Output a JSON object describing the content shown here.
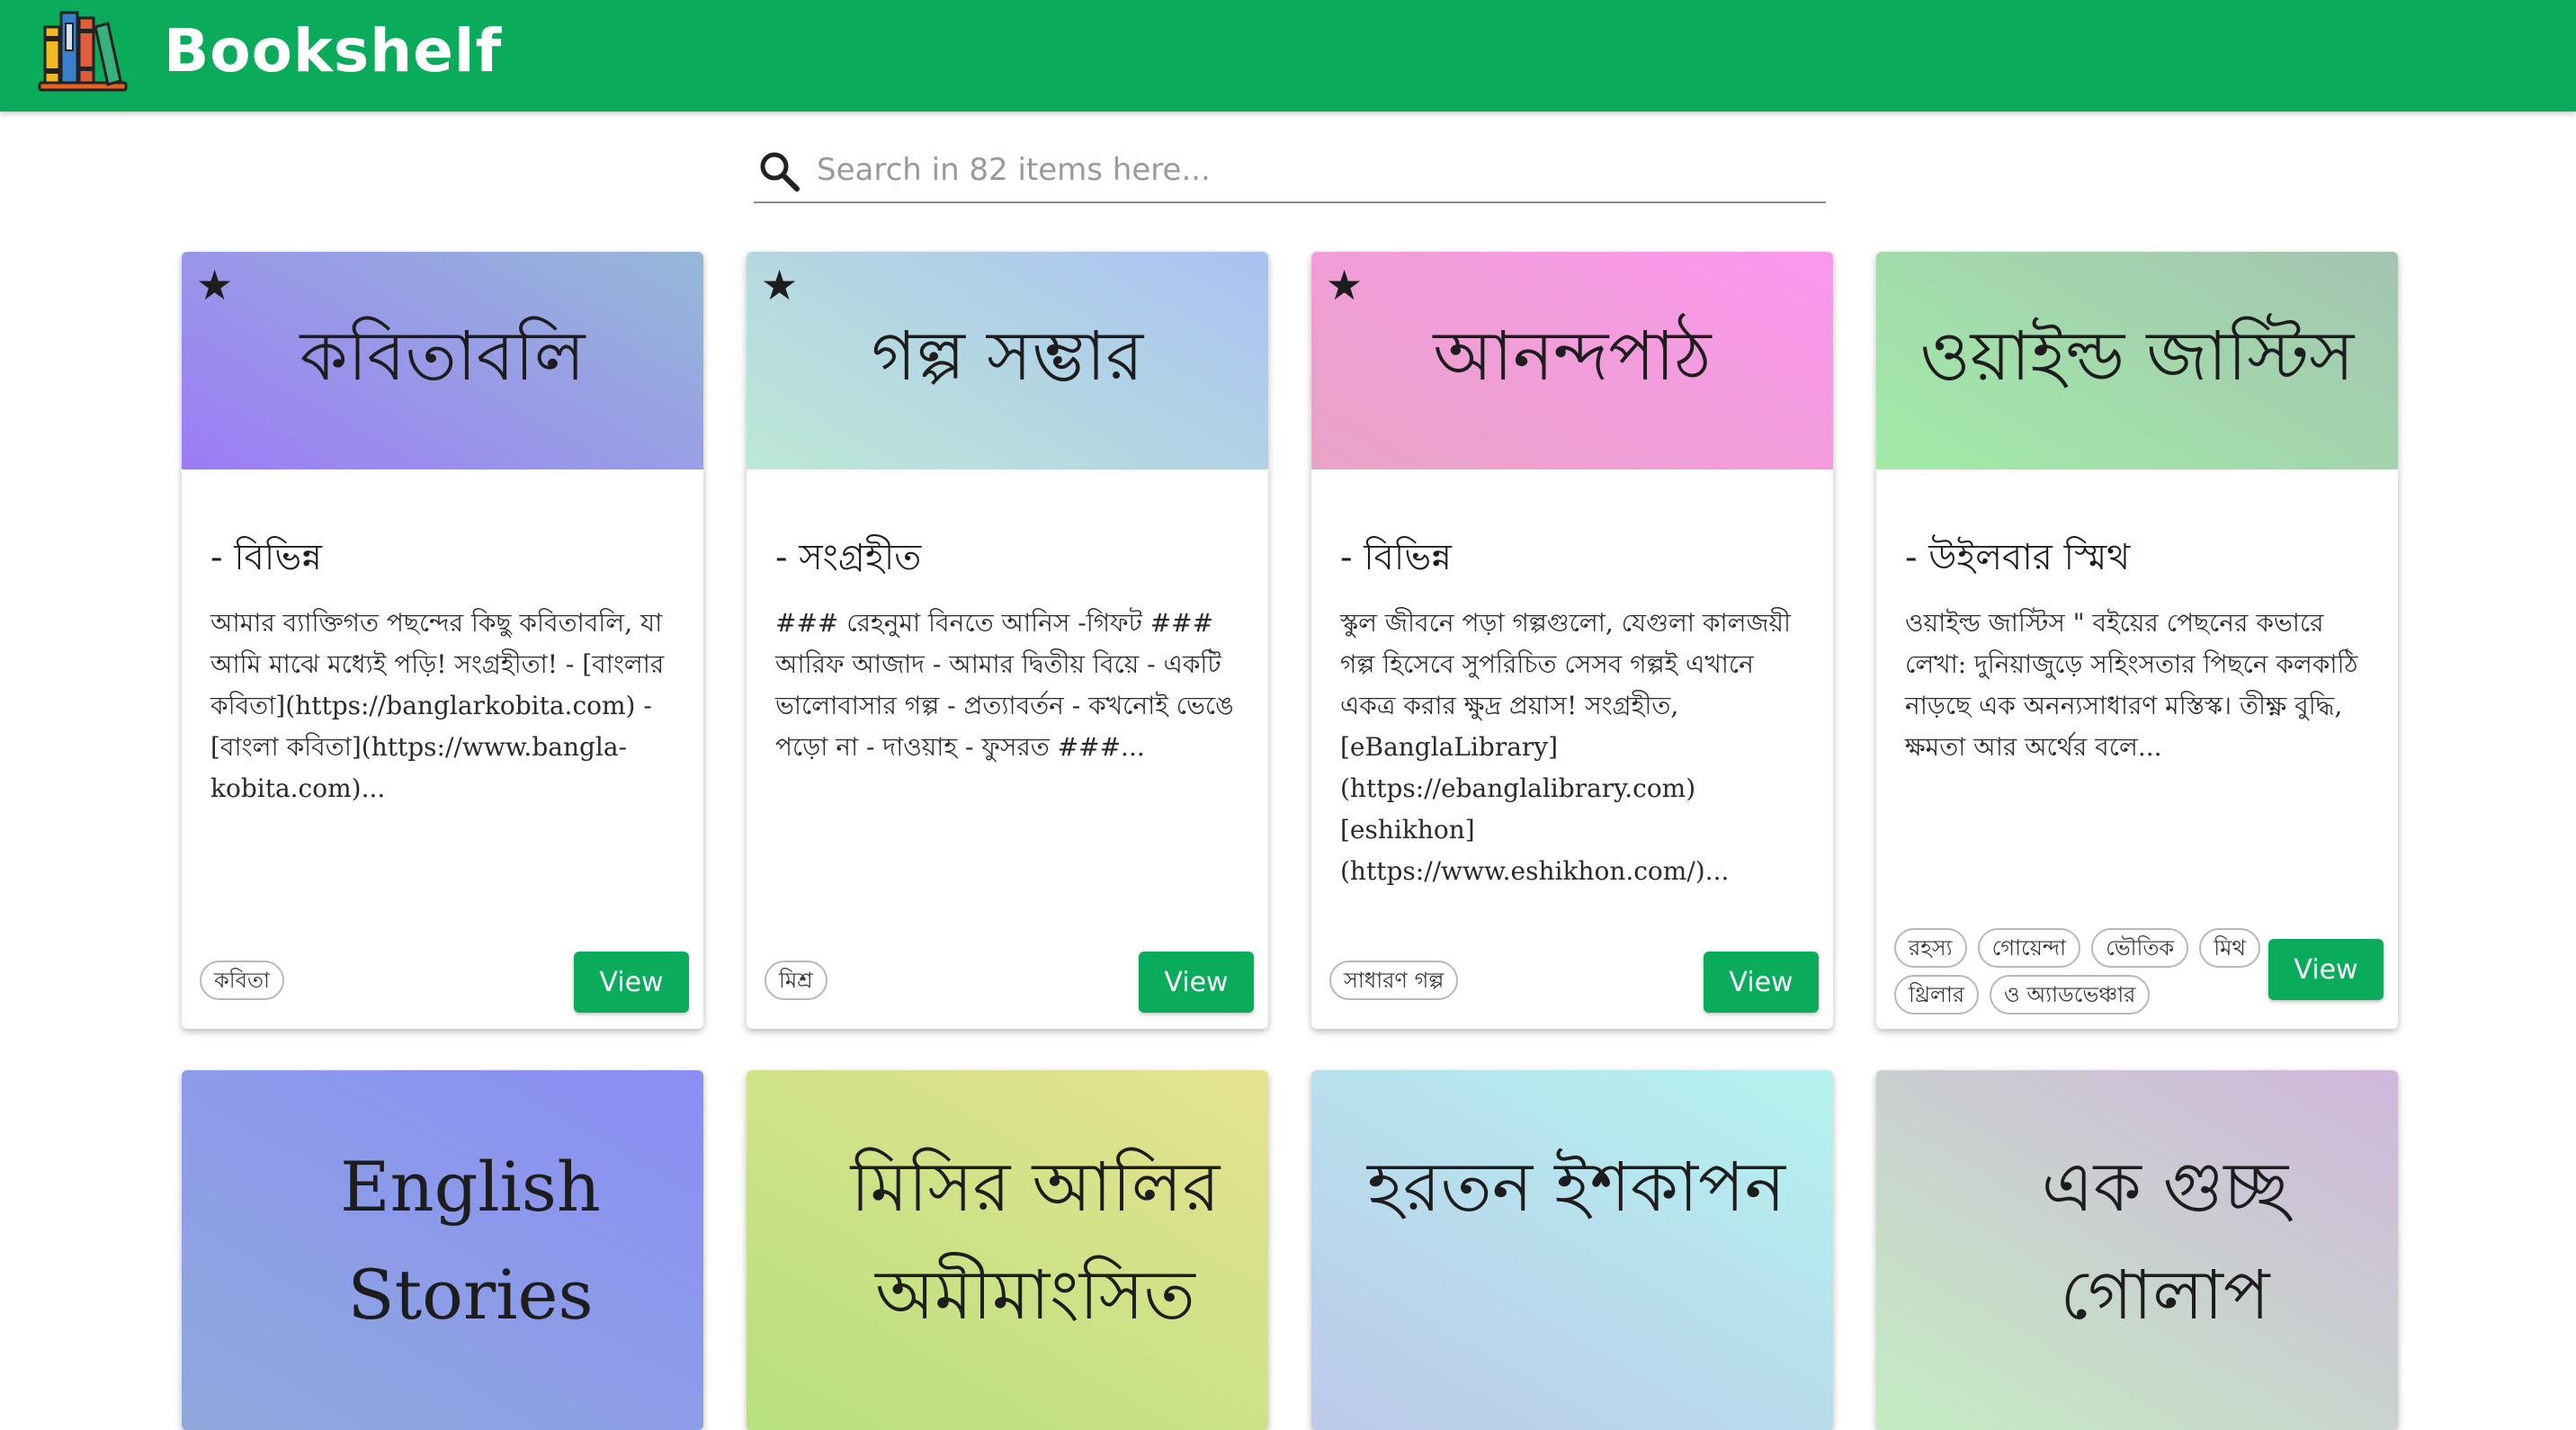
{
  "header": {
    "app_title": "Bookshelf"
  },
  "search": {
    "placeholder": "Search in 82 items here..."
  },
  "books": [
    {
      "title": "কবিতাবলি",
      "author": "- বিভিন্ন",
      "description": "আমার ব্যাক্তিগত পছন্দের কিছু কবিতাবলি, যা আমি মাঝে মধ্যেই পড়ি! সংগ্রহীতা! - [বাংলার কবিতা](https://banglarkobita.com) - [বাংলা কবিতা](https://www.bangla-kobita.com)...",
      "tags": [
        "কবিতা"
      ],
      "view_label": "View",
      "starred": true,
      "gradient": [
        "#9c7cf5",
        "#95b9d8"
      ]
    },
    {
      "title": "গল্প সম্ভার",
      "author": "- সংগ্রহীত",
      "description": "### রেহনুমা বিনতে আনিস -গিফট ### আরিফ আজাদ - আমার দ্বিতীয় বিয়ে - একটি ভালোবাসার গল্প - প্রত্যাবর্তন - কখনোই ভেঙে পড়ো না - দাওয়াহ - ফুসরত ###...",
      "tags": [
        "মিশ্র"
      ],
      "view_label": "View",
      "starred": true,
      "gradient": [
        "#bde8d6",
        "#a9c2f2"
      ]
    },
    {
      "title": "আনন্দপাঠ",
      "author": "- বিভিন্ন",
      "description": "স্কুল জীবনে পড়া গল্পগুলো, যেগুলা কালজয়ী গল্প হিসেবে সুপরিচিত সেসব গল্পই এখানে একত্র করার ক্ষুদ্র প্রয়াস! সংগ্রহীত, [eBanglaLibrary](https://ebanglalibrary.com) [eshikhon](https://www.eshikhon.com/)...",
      "tags": [
        "সাধারণ গল্প"
      ],
      "view_label": "View",
      "starred": true,
      "gradient": [
        "#e8a4c6",
        "#fb97ee"
      ]
    },
    {
      "title": "ওয়াইল্ড জাস্টিস",
      "author": "- উইলবার স্মিথ",
      "description": "ওয়াইল্ড জাস্টিস \" বইয়ের পেছনের কভারে লেখা: দুনিয়াজুড়ে সহিংসতার পিছনে কলকাঠি নাড়ছে এক অনন্যসাধারণ মস্তিস্ক। তীক্ষ্ণ বুদ্ধি, ক্ষমতা আর অর্থের বলে...",
      "tags": [
        "রহস্য",
        "গোয়েন্দা",
        "ভৌতিক",
        "মিথ",
        "থ্রিলার",
        "ও অ্যাডভেঞ্চার"
      ],
      "view_label": "View",
      "starred": false,
      "gradient": [
        "#a3eba7",
        "#a3c4b2"
      ]
    },
    {
      "title": "English Stories",
      "gradient": [
        "#8fa9dc",
        "#8a8ef5"
      ]
    },
    {
      "title": "মিসির আলির অমীমাংসিত",
      "gradient": [
        "#b7e07e",
        "#e6e38f"
      ]
    },
    {
      "title": "হরতন ইশকাপন",
      "gradient": [
        "#bcc9ea",
        "#b4f3ef"
      ]
    },
    {
      "title": "এক গুচ্ছ গোলাপ",
      "gradient": [
        "#c4ecc2",
        "#d0b6dc"
      ]
    }
  ],
  "icons": {
    "logo": "bookshelf-logo-icon",
    "search": "search-icon",
    "star": "star-icon"
  },
  "colors": {
    "primary": "#0aab5b"
  }
}
